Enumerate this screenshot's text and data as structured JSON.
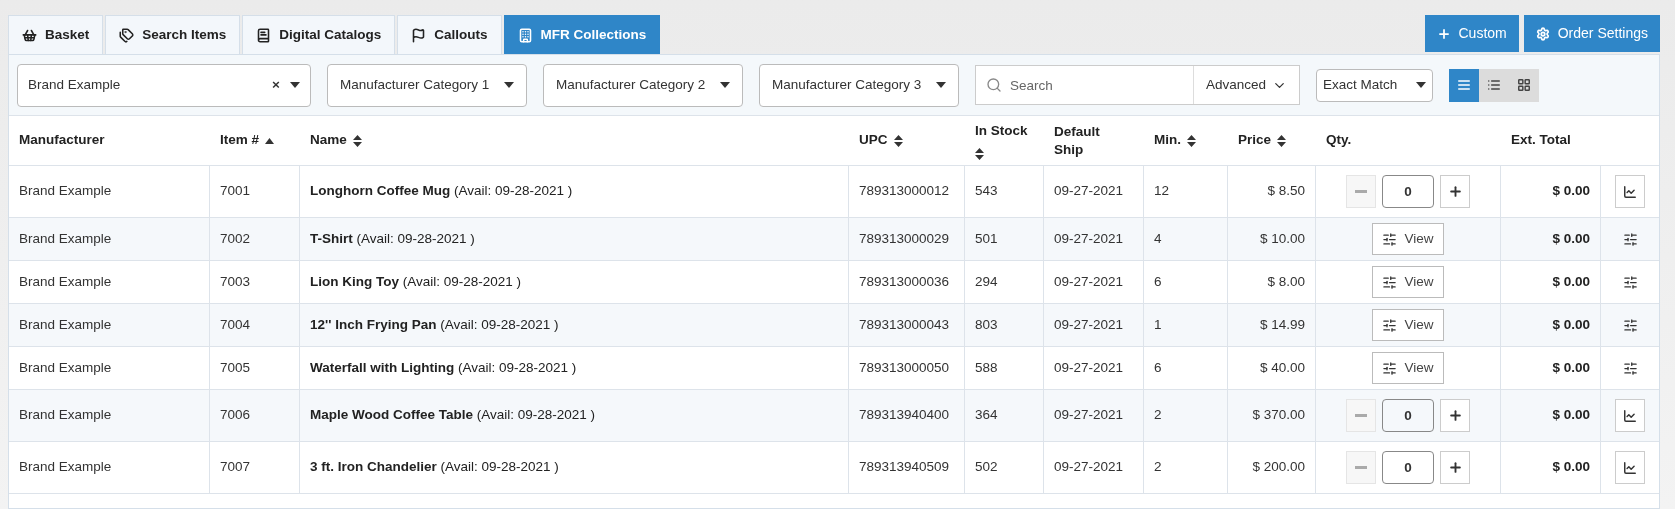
{
  "tabs": [
    {
      "label": "Basket",
      "selected": false
    },
    {
      "label": "Search Items",
      "selected": false
    },
    {
      "label": "Digital Catalogs",
      "selected": false
    },
    {
      "label": "Callouts",
      "selected": false
    },
    {
      "label": "MFR Collections",
      "selected": true
    }
  ],
  "actions": [
    {
      "label": "Custom"
    },
    {
      "label": "Order Settings"
    }
  ],
  "filters": {
    "brand": "Brand Example",
    "clear": "×",
    "categories": [
      "Manufacturer Category 1",
      "Manufacturer Category 2",
      "Manufacturer Category 3"
    ],
    "search": {
      "placeholder": "Search",
      "advanced": "Advanced"
    },
    "match": "Exact Match",
    "views": [
      {
        "selected": true
      },
      {
        "selected": false
      },
      {
        "selected": false
      }
    ]
  },
  "table": {
    "columns": [
      {
        "label": "Manufacturer",
        "sortable": false
      },
      {
        "label": "Item #",
        "sortable": true,
        "sorted": true
      },
      {
        "label": "Name",
        "sortable": true,
        "sorted": false
      },
      {
        "label": "UPC",
        "sortable": true,
        "sorted": false
      },
      {
        "label": "In Stock",
        "sortable": true,
        "sorted": false
      },
      {
        "label": "Default Ship",
        "sortable": false
      },
      {
        "label": "Min.",
        "sortable": true,
        "sorted": false
      },
      {
        "label": "Price",
        "sortable": true,
        "sorted": false
      },
      {
        "label": "Qty.",
        "sortable": false
      },
      {
        "label": "Ext. Total",
        "sortable": false
      }
    ],
    "rows": [
      {
        "kind": "qty",
        "manufacturer": "Brand Example",
        "item": "7001",
        "name": "**Longhorn Coffee Mug** (Avail: 09-28-2021 )",
        "upc": "789313000012",
        "stock": "543",
        "ship": "09-27-2021",
        "min": "12",
        "price": "$ 8.50",
        "qty": "0",
        "total": "$ 0.00"
      },
      {
        "kind": "view",
        "manufacturer": "Brand Example",
        "item": "7002",
        "name": "**T-Shirt** (Avail: 09-28-2021 )",
        "upc": "789313000029",
        "stock": "501",
        "ship": "09-27-2021",
        "min": "4",
        "price": "$ 10.00",
        "view": "View",
        "total": "$ 0.00"
      },
      {
        "kind": "view",
        "manufacturer": "Brand Example",
        "item": "7003",
        "name": "**Lion King Toy** (Avail: 09-28-2021 )",
        "upc": "789313000036",
        "stock": "294",
        "ship": "09-27-2021",
        "min": "6",
        "price": "$ 8.00",
        "view": "View",
        "total": "$ 0.00"
      },
      {
        "kind": "view",
        "manufacturer": "Brand Example",
        "item": "7004",
        "name": "**12'' Inch Frying Pan** (Avail: 09-28-2021 )",
        "upc": "789313000043",
        "stock": "803",
        "ship": "09-27-2021",
        "min": "1",
        "price": "$ 14.99",
        "view": "View",
        "total": "$ 0.00"
      },
      {
        "kind": "view",
        "manufacturer": "Brand Example",
        "item": "7005",
        "name": "**Waterfall with Lighting** (Avail: 09-28-2021 )",
        "upc": "789313000050",
        "stock": "588",
        "ship": "09-27-2021",
        "min": "6",
        "price": "$ 40.00",
        "view": "View",
        "total": "$ 0.00"
      },
      {
        "kind": "qty",
        "manufacturer": "Brand Example",
        "item": "7006",
        "name": "**Maple Wood Coffee Table** (Avail: 09-28-2021 )",
        "upc": "789313940400",
        "stock": "364",
        "ship": "09-27-2021",
        "min": "2",
        "price": "$ 370.00",
        "qty": "0",
        "total": "$ 0.00"
      },
      {
        "kind": "qty",
        "manufacturer": "Brand Example",
        "item": "7007",
        "name": "**3 ft. Iron Chandelier** (Avail: 09-28-2021 )",
        "upc": "789313940509",
        "stock": "502",
        "ship": "09-27-2021",
        "min": "2",
        "price": "$ 200.00",
        "qty": "0",
        "total": "$ 0.00"
      }
    ]
  }
}
